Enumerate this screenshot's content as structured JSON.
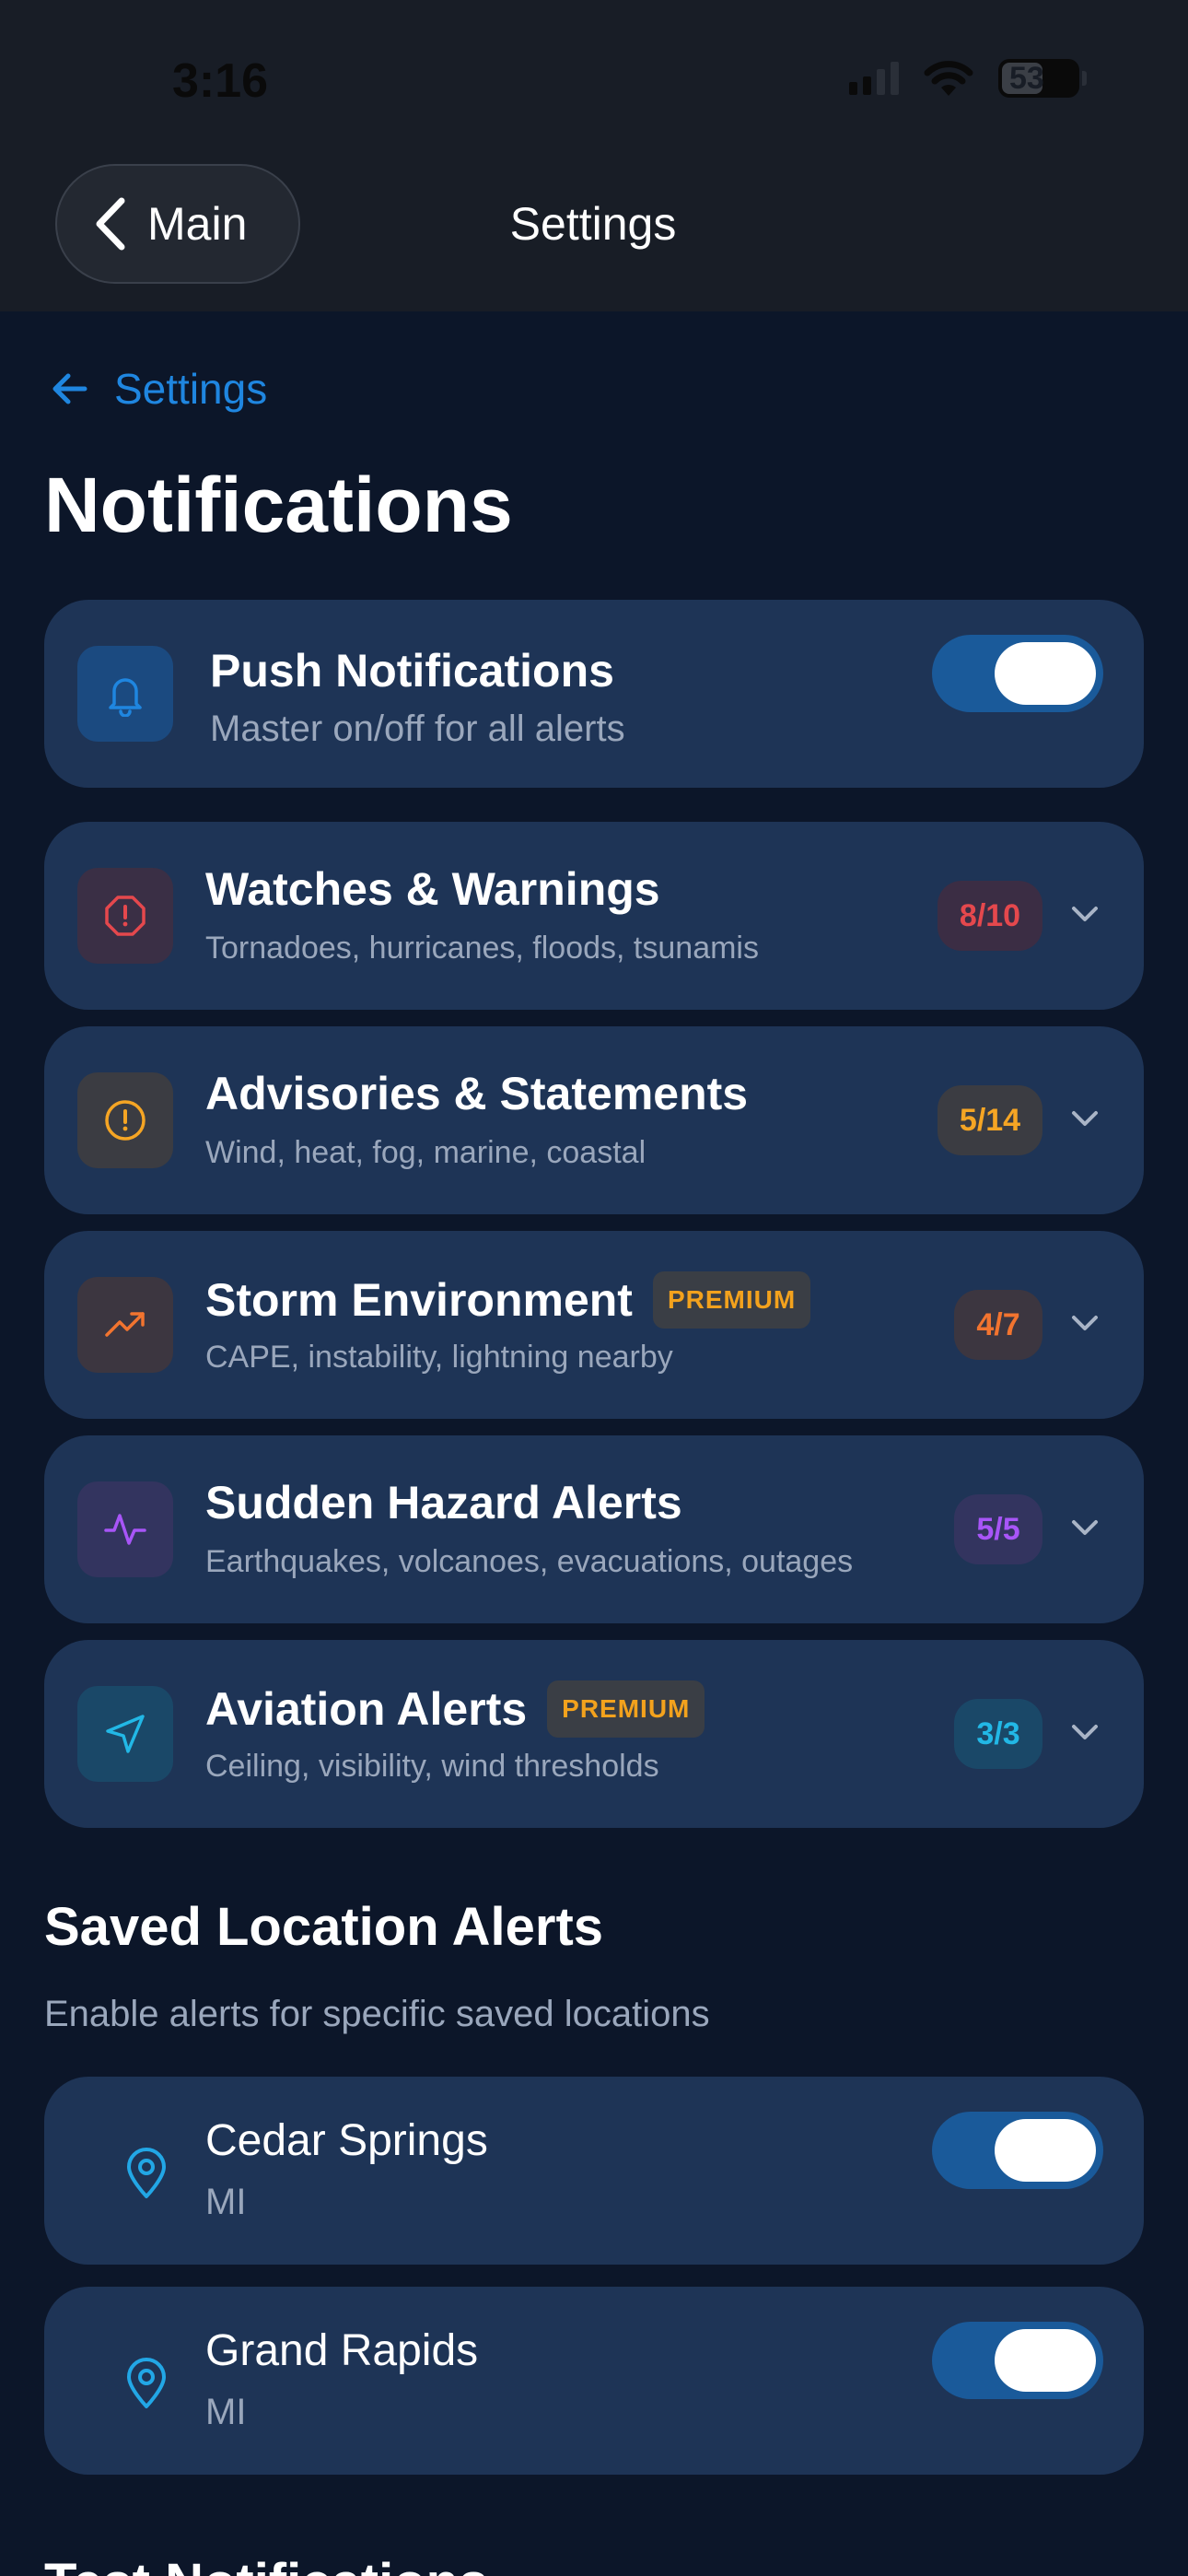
{
  "status_bar": {
    "time": "3:16",
    "battery": "53"
  },
  "nav": {
    "back_label": "Main",
    "title": "Settings"
  },
  "breadcrumb": {
    "label": "Settings"
  },
  "page": {
    "title": "Notifications"
  },
  "push": {
    "title": "Push Notifications",
    "subtitle": "Master on/off for all alerts",
    "enabled": true,
    "icon": "bell-icon"
  },
  "categories": [
    {
      "title": "Watches & Warnings",
      "subtitle": "Tornadoes, hurricanes, floods, tsunamis",
      "count": "8/10",
      "premium": false,
      "icon": "octagon-alert-icon",
      "color": "#e5484d"
    },
    {
      "title": "Advisories & Statements",
      "subtitle": "Wind, heat, fog, marine, coastal",
      "count": "5/14",
      "premium": false,
      "icon": "circle-alert-icon",
      "color": "#f5a524"
    },
    {
      "title": "Storm Environment",
      "subtitle": "CAPE, instability, lightning nearby",
      "count": "4/7",
      "premium": true,
      "icon": "trending-up-icon",
      "color": "#f2742f"
    },
    {
      "title": "Sudden Hazard Alerts",
      "subtitle": "Earthquakes, volcanoes, evacuations, outages",
      "count": "5/5",
      "premium": false,
      "icon": "activity-icon",
      "color": "#a855f7"
    },
    {
      "title": "Aviation Alerts",
      "subtitle": "Ceiling, visibility, wind thresholds",
      "count": "3/3",
      "premium": true,
      "icon": "navigation-icon",
      "color": "#22b8e6"
    }
  ],
  "premium_label": "PREMIUM",
  "saved_locations": {
    "title": "Saved Location Alerts",
    "subtitle": "Enable alerts for specific saved locations",
    "items": [
      {
        "name": "Cedar Springs",
        "state": "MI",
        "enabled": true
      },
      {
        "name": "Grand Rapids",
        "state": "MI",
        "enabled": true
      }
    ]
  },
  "next_section": {
    "title": "Test Notifications"
  }
}
